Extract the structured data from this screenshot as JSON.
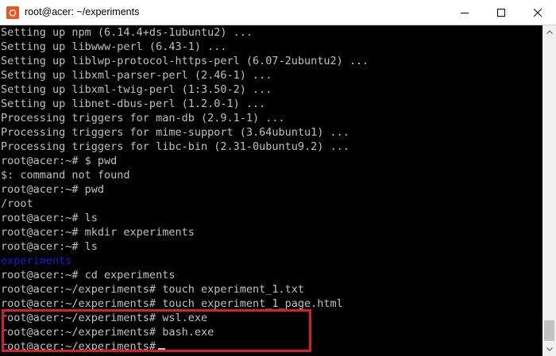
{
  "window": {
    "title": "root@acer: ~/experiments",
    "icon": "ubuntu-logo-icon",
    "accent_color": "#e95420",
    "controls": {
      "minimize_icon": "minimize-icon",
      "maximize_icon": "maximize-icon",
      "close_icon": "close-icon"
    }
  },
  "terminal": {
    "text_color": "#c0c0c0",
    "dir_color": "#1a1ad8",
    "highlight_color": "#d4202a",
    "lines": [
      "Setting up npm (6.14.4+ds-1ubuntu2) ...",
      "Setting up libwww-perl (6.43-1) ...",
      "Setting up liblwp-protocol-https-perl (6.07-2ubuntu2) ...",
      "Setting up libxml-parser-perl (2.46-1) ...",
      "Setting up libxml-twig-perl (1:3.50-2) ...",
      "Setting up libnet-dbus-perl (1.2.0-1) ...",
      "Processing triggers for man-db (2.9.1-1) ...",
      "Processing triggers for mime-support (3.64ubuntu1) ...",
      "Processing triggers for libc-bin (2.31-0ubuntu9.2) ...",
      "root@acer:~# $ pwd",
      "$: command not found",
      "root@acer:~# pwd",
      "/root",
      "root@acer:~# ls",
      "root@acer:~# mkdir experiments",
      "root@acer:~# ls",
      "experiments",
      "root@acer:~# cd experiments",
      "root@acer:~/experiments# touch experiment_1.txt",
      "root@acer:~/experiments# touch experiment_1_page.html",
      "root@acer:~/experiments# wsl.exe",
      "root@acer:~/experiments# bash.exe",
      "root@acer:~/experiments#"
    ]
  }
}
